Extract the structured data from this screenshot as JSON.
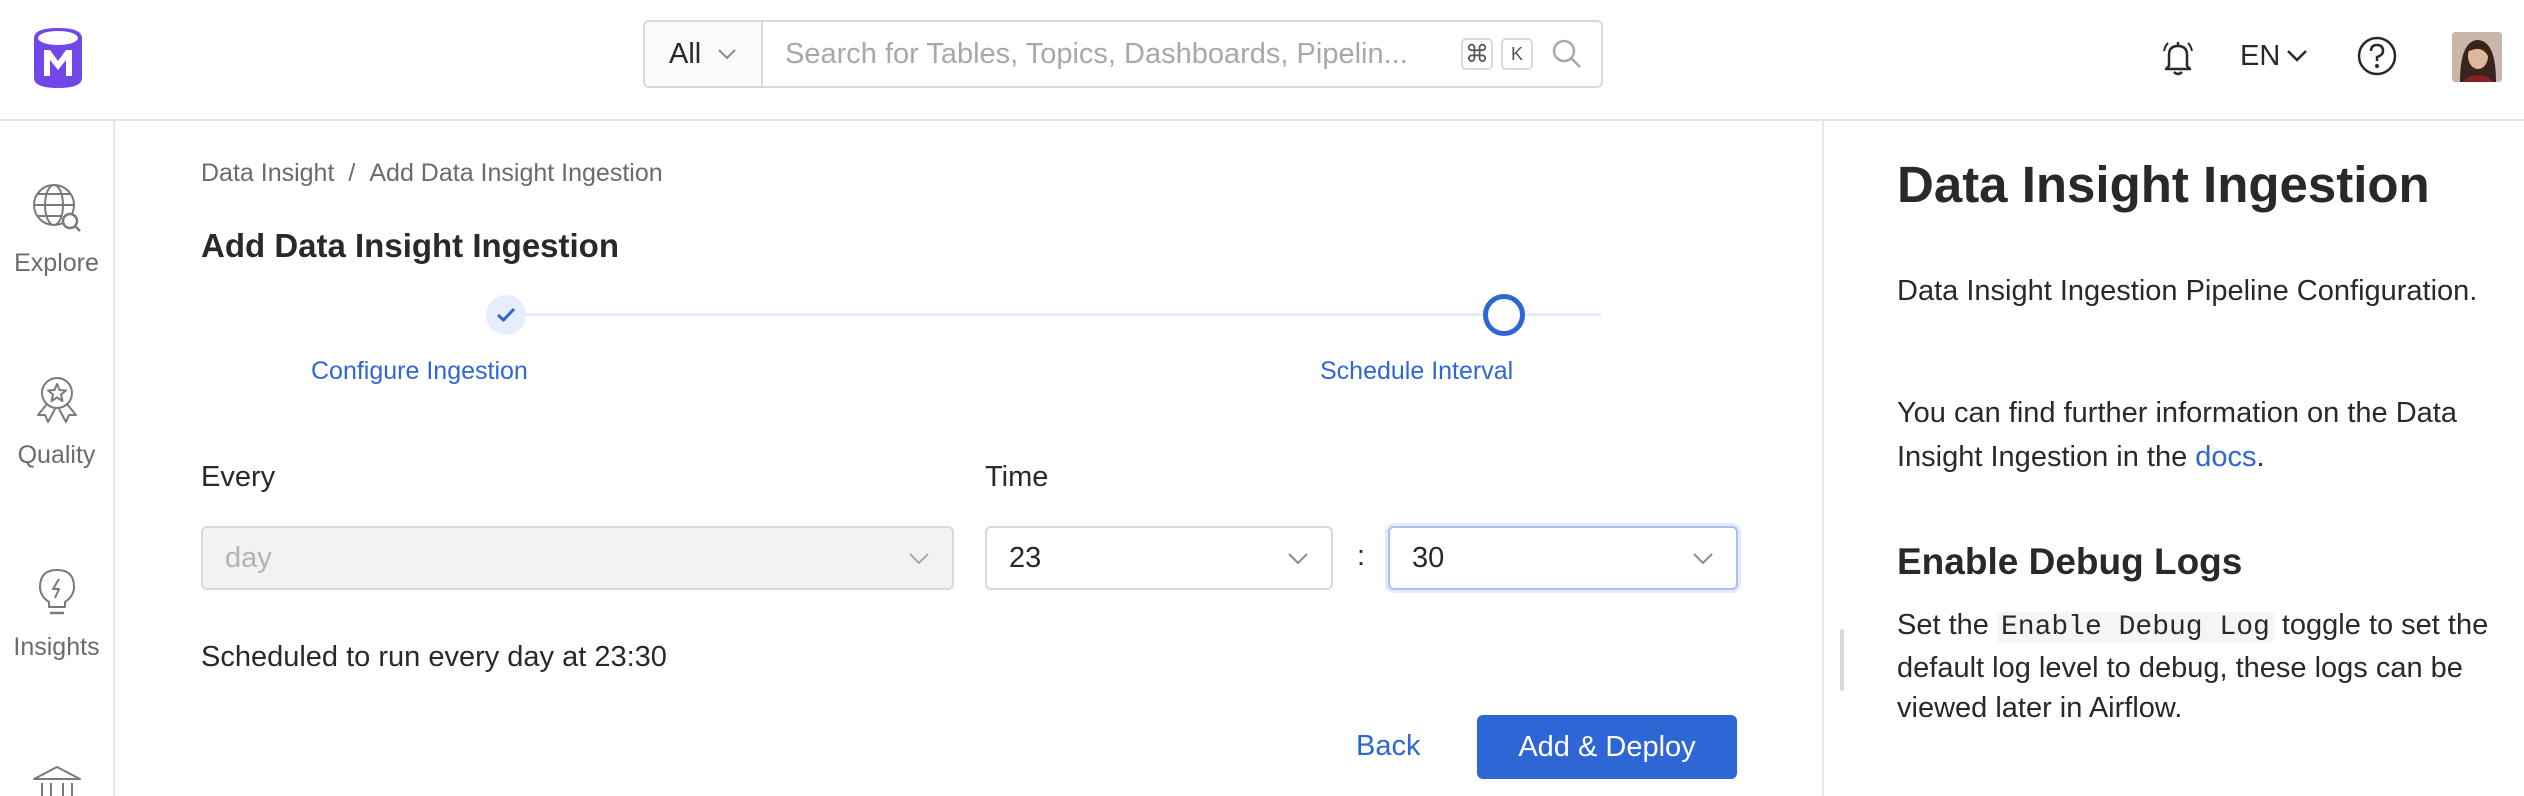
{
  "navbar": {
    "search_scope": "All",
    "search_placeholder": "Search for Tables, Topics, Dashboards, Pipelin...",
    "kbd_cmd": "⌘",
    "kbd_k": "K",
    "language": "EN"
  },
  "sidebar": {
    "items": [
      {
        "label": "Explore",
        "icon": "globe-search-icon"
      },
      {
        "label": "Quality",
        "icon": "award-icon"
      },
      {
        "label": "Insights",
        "icon": "lightbulb-icon"
      },
      {
        "label": "",
        "icon": "governance-icon"
      }
    ]
  },
  "main": {
    "breadcrumb": [
      "Data Insight",
      "Add Data Insight Ingestion"
    ],
    "breadcrumb_sep": "/",
    "title": "Add Data Insight Ingestion",
    "steps": [
      {
        "label": "Configure Ingestion",
        "status": "done"
      },
      {
        "label": "Schedule Interval",
        "status": "active"
      }
    ],
    "every_label": "Every",
    "every_value": "day",
    "time_label": "Time",
    "hour_value": "23",
    "time_sep": ":",
    "minute_value": "30",
    "schedule_text": "Scheduled to run every day at 23:30",
    "back_label": "Back",
    "deploy_label": "Add & Deploy"
  },
  "right_panel": {
    "title": "Data Insight Ingestion",
    "p1": "Data Insight Ingestion Pipeline Configuration.",
    "p2_before": "You can find further information on the Data Insight Ingestion in the ",
    "p2_link": "docs",
    "p2_after": ".",
    "h2": "Enable Debug Logs",
    "p3_before": "Set the ",
    "p3_code": "Enable Debug Log",
    "p3_after": " toggle to set the default log level to debug, these logs can be viewed later in Airflow."
  },
  "colors": {
    "primary": "#2f66d6",
    "logo": "#7147e8",
    "text": "#292929",
    "muted": "#6b6b6b"
  }
}
